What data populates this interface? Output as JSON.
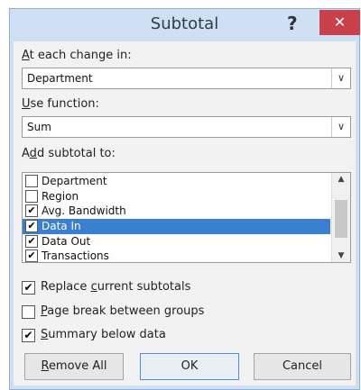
{
  "window": {
    "title": "Subtotal",
    "help_label": "?",
    "close_label": "✕"
  },
  "group_by": {
    "label_prefix": "",
    "label_access": "A",
    "label_rest": "t each change in:",
    "value": "Department"
  },
  "function": {
    "label_access": "U",
    "label_rest": "se function:",
    "value": "Sum"
  },
  "subtotal_to": {
    "label_pre": "A",
    "label_access": "d",
    "label_rest": "d subtotal to:",
    "items": [
      {
        "label": "Department",
        "checked": false,
        "mark": ""
      },
      {
        "label": "Region",
        "checked": false,
        "mark": ""
      },
      {
        "label": "Avg. Bandwidth",
        "checked": true,
        "mark": "✔"
      },
      {
        "label": "Data In",
        "checked": true,
        "mark": "✔",
        "selected": true
      },
      {
        "label": "Data Out",
        "checked": true,
        "mark": "✔"
      },
      {
        "label": "Transactions",
        "checked": true,
        "mark": "✔"
      }
    ]
  },
  "options": {
    "replace": {
      "pre": "Replace ",
      "access": "c",
      "rest": "urrent subtotals",
      "checked": true,
      "mark": "✔"
    },
    "page_break": {
      "pre": "",
      "access": "P",
      "rest": "age break between groups",
      "checked": false,
      "mark": ""
    },
    "summary": {
      "pre": "",
      "access": "S",
      "rest": "ummary below data",
      "checked": true,
      "mark": "✔"
    }
  },
  "buttons": {
    "remove_all": {
      "access": "R",
      "rest": "emove All"
    },
    "ok": "OK",
    "cancel": "Cancel"
  },
  "icons": {
    "dropdown": "chevron-down-icon",
    "scroll_up": "chevron-up-icon",
    "scroll_down": "chevron-down-icon",
    "check": "checkmark-icon"
  }
}
